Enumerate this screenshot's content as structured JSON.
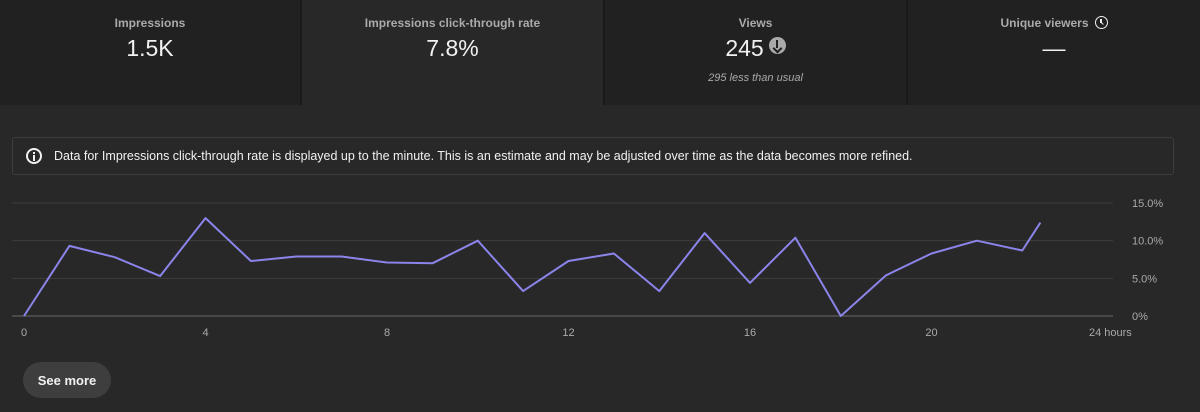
{
  "metrics": [
    {
      "label": "Impressions",
      "value": "1.5K",
      "sub": ""
    },
    {
      "label": "Impressions click-through rate",
      "value": "7.8%",
      "sub": ""
    },
    {
      "label": "Views",
      "value": "245",
      "sub": "295 less than usual"
    },
    {
      "label": "Unique viewers",
      "value": "—",
      "sub": ""
    }
  ],
  "notice": {
    "text": "Data for Impressions click-through rate is displayed up to the minute. This is an estimate and may be adjusted over time as the data becomes more refined."
  },
  "see_more_label": "See more",
  "colors": {
    "line": "#8b84ea",
    "background": "#282828",
    "tiles": "#212121",
    "selected_tile": "#282828"
  },
  "icons": {
    "views_trend": "arrow-down-circle-icon",
    "unique_viewers": "clock-icon",
    "notice": "info-icon"
  },
  "chart_data": {
    "type": "line",
    "x": [
      0,
      1,
      2,
      3,
      4,
      5,
      6,
      7,
      8,
      9,
      10,
      11,
      12,
      13,
      14,
      15,
      16,
      17,
      18,
      19,
      20,
      21,
      22,
      22.4
    ],
    "y": [
      0,
      9.3,
      7.8,
      5.3,
      13.0,
      7.3,
      7.9,
      7.9,
      7.1,
      7.0,
      10.0,
      3.3,
      7.3,
      8.3,
      3.3,
      11.0,
      4.4,
      10.4,
      0,
      5.4,
      8.3,
      10.0,
      8.7,
      12.4
    ],
    "series_color": "#8b84ea",
    "xlim": [
      0,
      24
    ],
    "ylim": [
      0,
      15
    ],
    "x_ticks": [
      0,
      4,
      8,
      12,
      16,
      20
    ],
    "x_tick_labels": [
      "0",
      "4",
      "8",
      "12",
      "16",
      "20"
    ],
    "x_end_label": "24 hours",
    "y_ticks": [
      0,
      5,
      10,
      15
    ],
    "y_tick_labels": [
      "0%",
      "5.0%",
      "10.0%",
      "15.0%"
    ],
    "grid": true,
    "y_axis_position": "right"
  }
}
